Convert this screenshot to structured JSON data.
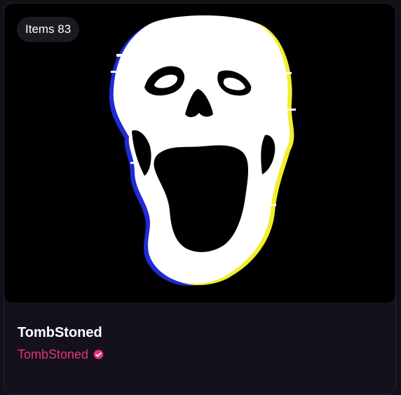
{
  "collection": {
    "items_badge": "Items 83",
    "title": "TombStoned",
    "creator": "TombStoned",
    "artwork_icon": "glitch-skull-artwork",
    "verified_icon": "verified-check-badge-icon"
  },
  "colors": {
    "background": "#141019",
    "card": "#15111c",
    "badge_bg": "#1c1a21",
    "accent_pink": "#e0337c",
    "artwork_bg": "#000000",
    "glitch_yellow": "#f2ef2a",
    "glitch_blue": "#1e2bd6"
  }
}
